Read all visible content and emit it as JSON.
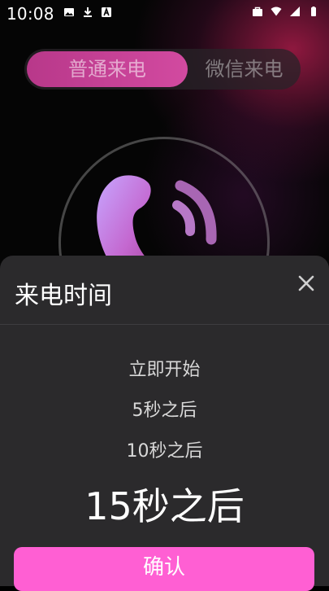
{
  "status_bar": {
    "time": "10:08",
    "left_icons": [
      "image-icon",
      "download-icon",
      "a-box-icon"
    ],
    "right_icons": [
      "bag-icon",
      "wifi-icon",
      "signal-icon",
      "battery-icon"
    ]
  },
  "tabs": [
    {
      "label": "普通来电",
      "active": true
    },
    {
      "label": "微信来电",
      "active": false
    }
  ],
  "sheet": {
    "title": "来电时间",
    "options": [
      "立即开始",
      "5秒之后",
      "10秒之后"
    ],
    "selected_option": "15秒之后",
    "confirm_label": "确认"
  },
  "colors": {
    "accent": "#ff5fd3",
    "tab_active": "#c2408f",
    "sheet_bg": "#2b2a2c"
  }
}
